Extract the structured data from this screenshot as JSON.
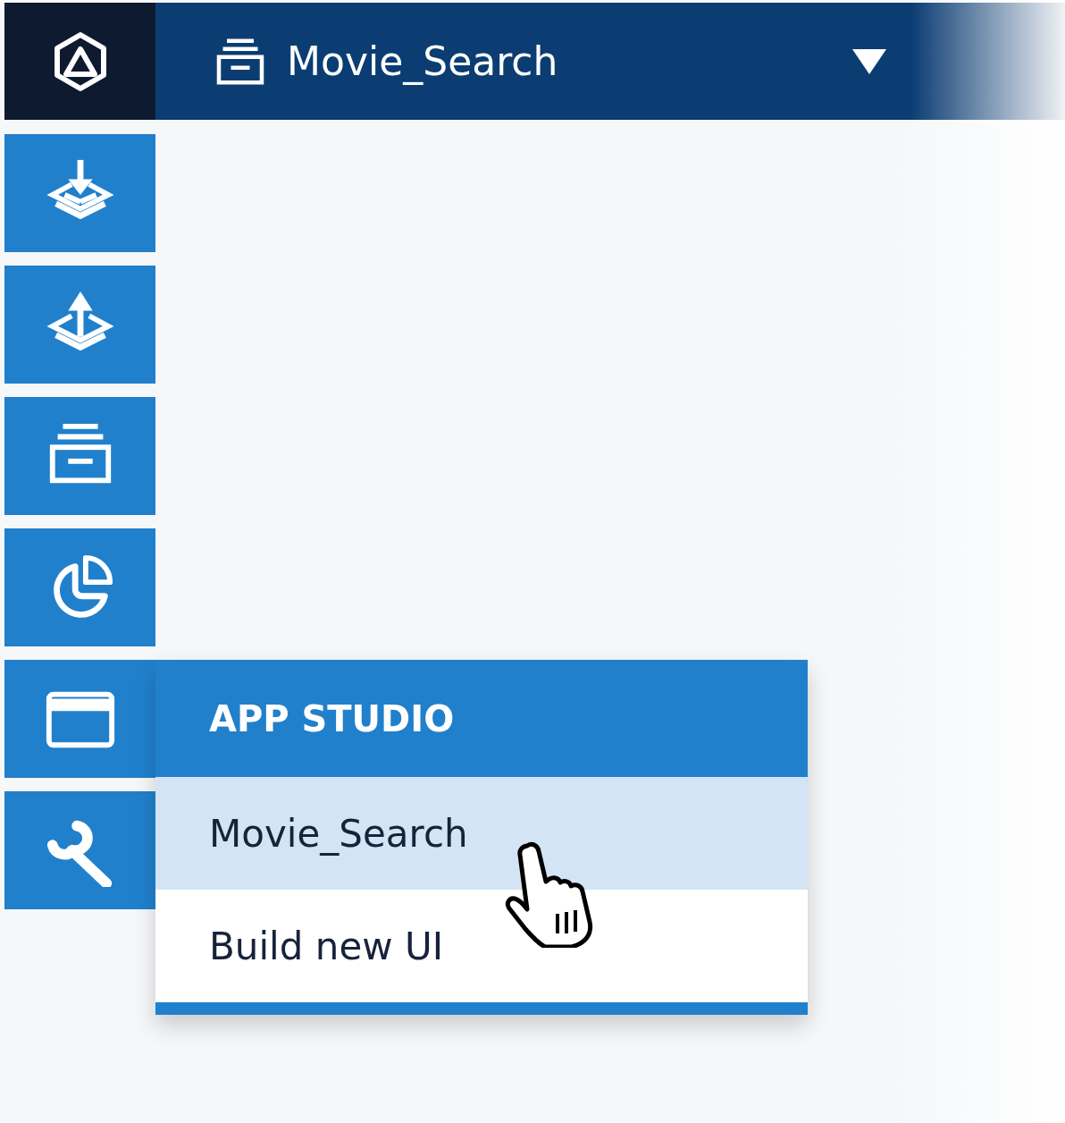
{
  "header": {
    "title": "Movie_Search"
  },
  "sidebar": {
    "items": [
      {
        "expanded": false
      },
      {
        "expanded": false
      },
      {
        "expanded": false
      },
      {
        "expanded": false
      },
      {
        "expanded": true
      },
      {
        "expanded": false
      }
    ]
  },
  "flyout": {
    "title": "APP STUDIO",
    "items": [
      {
        "label": "Movie_Search",
        "selected": true
      },
      {
        "label": "Build new UI",
        "selected": false
      }
    ]
  }
}
